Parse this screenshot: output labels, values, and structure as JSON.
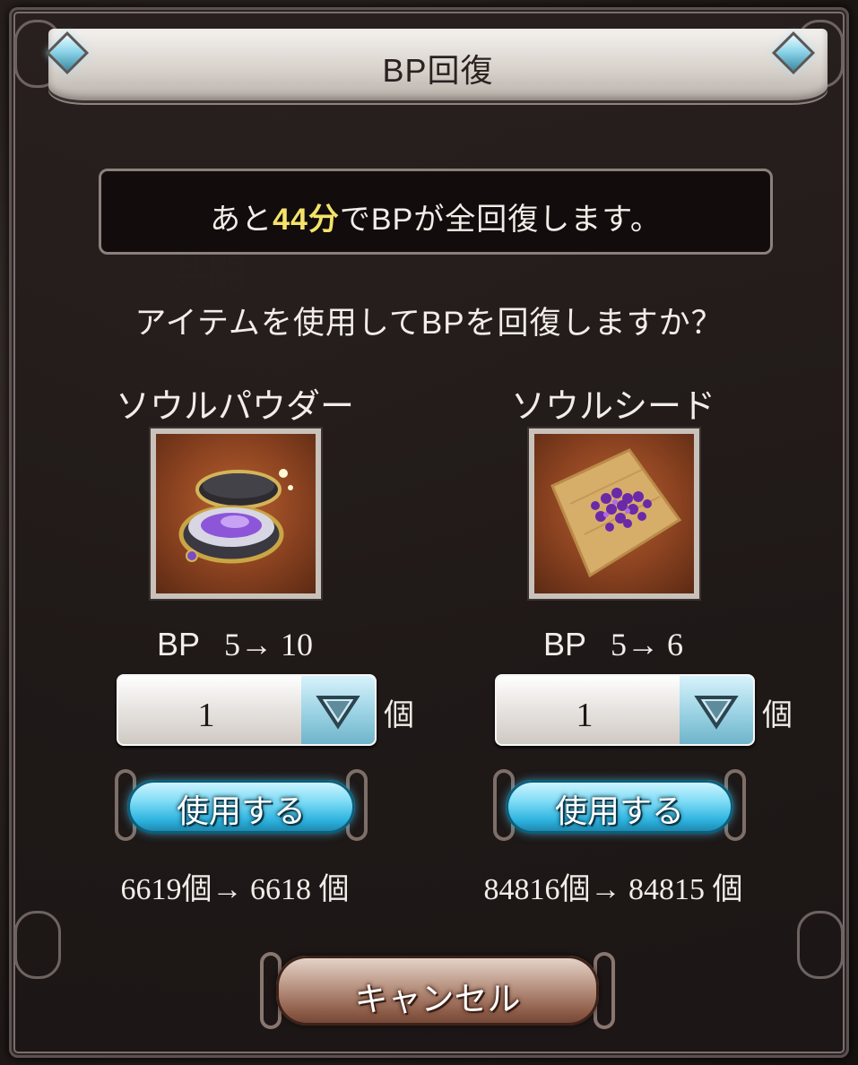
{
  "dialog": {
    "title": "BP回復",
    "timer": {
      "prefix": "あと",
      "highlight": "44分",
      "suffix": "でBPが全回復します。"
    },
    "question": "アイテムを使用してBPを回復しますか？"
  },
  "items": [
    {
      "name": "ソウルパウダー",
      "icon": "soul-powder-icon",
      "bp_label": "BP",
      "bp_change": "5→ 10",
      "quantity": "1",
      "unit": "個",
      "use_label": "使用する",
      "stock": "6619個→ 6618 個"
    },
    {
      "name": "ソウルシード",
      "icon": "soul-seed-icon",
      "bp_label": "BP",
      "bp_change": "5→ 6",
      "quantity": "1",
      "unit": "個",
      "use_label": "使用する",
      "stock": "84816個→ 84815 個"
    }
  ],
  "cancel_label": "キャンセル",
  "colors": {
    "highlight": "#f4e36b",
    "use_button": "#2db3df",
    "cancel_button": "#8e5d49"
  }
}
